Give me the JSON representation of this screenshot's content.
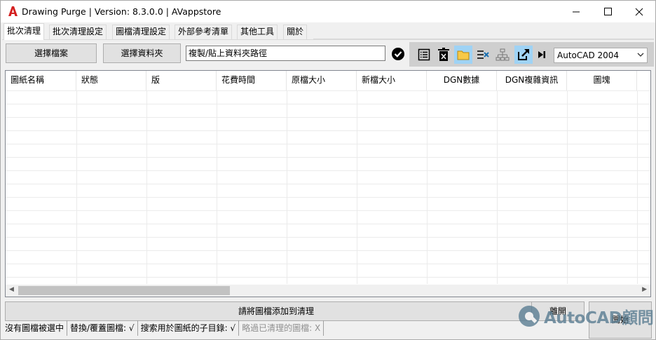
{
  "window": {
    "title": "Drawing Purge  | Version: 8.3.0.0 |  AVappstore"
  },
  "tabs": [
    {
      "label": "批次清理"
    },
    {
      "label": "批次清理設定"
    },
    {
      "label": "圖檔清理設定"
    },
    {
      "label": "外部參考清單"
    },
    {
      "label": "其他工具"
    },
    {
      "label": "關於"
    }
  ],
  "toolbar": {
    "select_files_label": "選擇檔案",
    "select_folder_label": "選擇資料夾",
    "path_value": "複製/貼上資料夾路徑",
    "version_selected": "AutoCAD 2004",
    "icons": [
      "list-icon",
      "delete-icon",
      "folder-icon",
      "clear-list-icon",
      "tree-icon",
      "export-icon",
      "skip-to-end-icon"
    ]
  },
  "grid": {
    "columns": [
      "圖紙名稱",
      "狀態",
      "版",
      "花費時間",
      "原檔大小",
      "新檔大小",
      "DGN數據",
      "DGN複雜資訊",
      "圖塊"
    ]
  },
  "actions": {
    "add_prompt": "請將圖檔添加到清理",
    "exit_label": "離開",
    "start_label": "開始"
  },
  "statusbar": {
    "no_selection": "沒有圖檔被選中",
    "replace": "替換/覆蓋圖檔: √",
    "search_sub": "搜索用於圖紙的子目錄: √",
    "skip_cleaned": "略過已清理的圖檔: X"
  },
  "watermark": {
    "text": "AutoCAD顧問"
  },
  "colors": {
    "accent": "#9fd3f5",
    "brand_red": "#d42020"
  }
}
